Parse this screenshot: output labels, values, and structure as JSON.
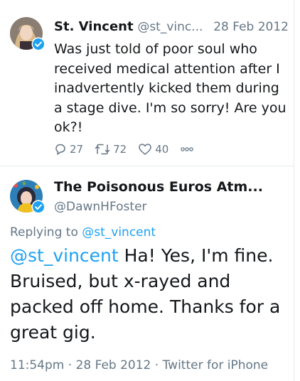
{
  "tweet1": {
    "display_name": "St. Vincent",
    "handle": "@st_vinc...",
    "date": "28 Feb 2012",
    "text": "Was just told of poor soul who received medical attention after I inadvertently kicked them during a stage dive. I'm so sorry!  Are you ok?!",
    "reply_count": "27",
    "retweet_count": "72",
    "like_count": "40"
  },
  "tweet2": {
    "display_name": "The Poisonous Euros Atm...",
    "handle": "@DawnHFoster",
    "replying_to_prefix": "Replying to ",
    "replying_to_handle": "@st_vincent",
    "mention": "@st_vincent",
    "text": " Ha! Yes, I'm fine. Bruised, but x-rayed and packed off home. Thanks for a great gig.",
    "time": "11:54pm",
    "date": "28 Feb 2012",
    "source": "Twitter for iPhone",
    "separator": " · "
  },
  "colors": {
    "accent": "#1da1f2",
    "secondary_text": "#657786",
    "border": "#e6ecf0"
  },
  "icons": [
    "reply-icon",
    "retweet-icon",
    "like-icon",
    "more-icon",
    "verified-icon"
  ]
}
